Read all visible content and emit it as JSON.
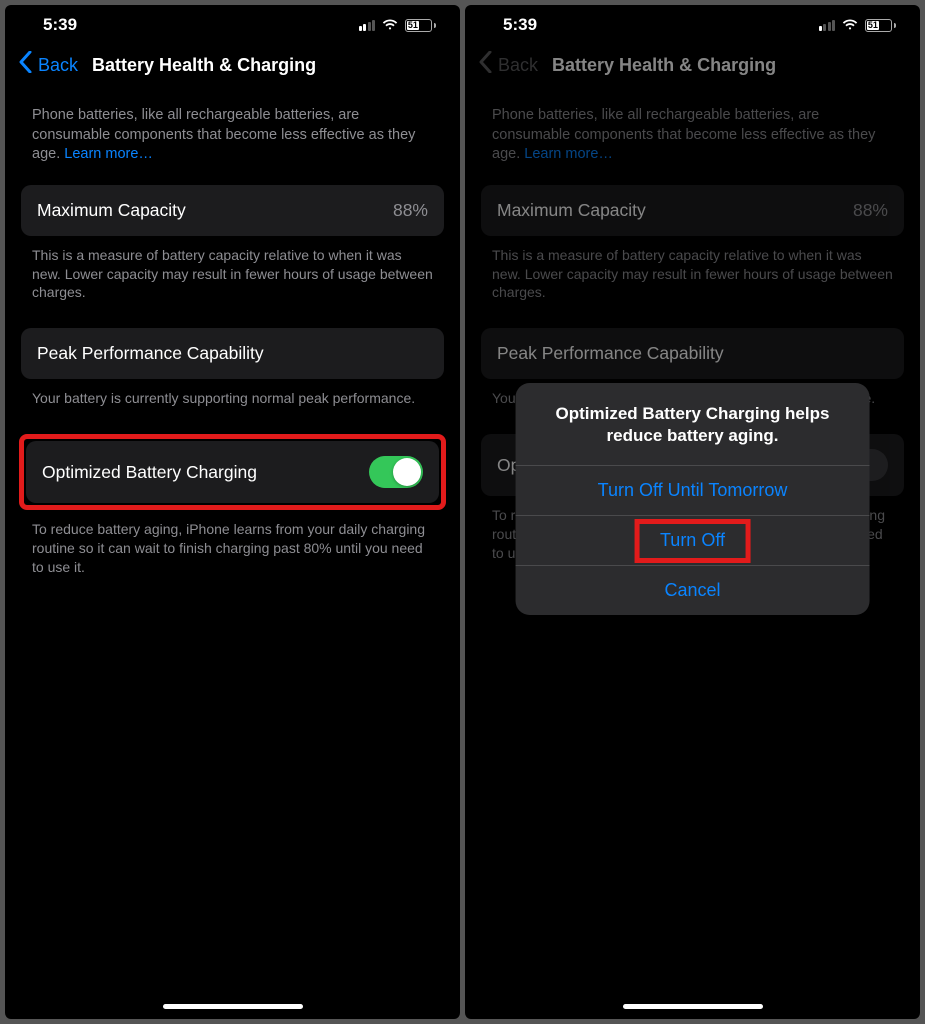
{
  "status": {
    "time": "5:39",
    "battery_pct": "51"
  },
  "nav": {
    "back": "Back",
    "title": "Battery Health & Charging"
  },
  "intro": {
    "text": "Phone batteries, like all rechargeable batteries, are consumable components that become less effective as they age. ",
    "link": "Learn more…"
  },
  "capacity": {
    "label": "Maximum Capacity",
    "value": "88%",
    "footer": "This is a measure of battery capacity relative to when it was new. Lower capacity may result in fewer hours of usage between charges."
  },
  "peak": {
    "label": "Peak Performance Capability",
    "footer": "Your battery is currently supporting normal peak performance."
  },
  "optimized": {
    "label": "Optimized Battery Charging",
    "footer": "To reduce battery aging, iPhone learns from your daily charging routine so it can wait to finish charging past 80% until you need to use it."
  },
  "sheet": {
    "title": "Optimized Battery Charging helps reduce battery aging.",
    "btn1": "Turn Off Until Tomorrow",
    "btn2": "Turn Off",
    "btn3": "Cancel"
  }
}
